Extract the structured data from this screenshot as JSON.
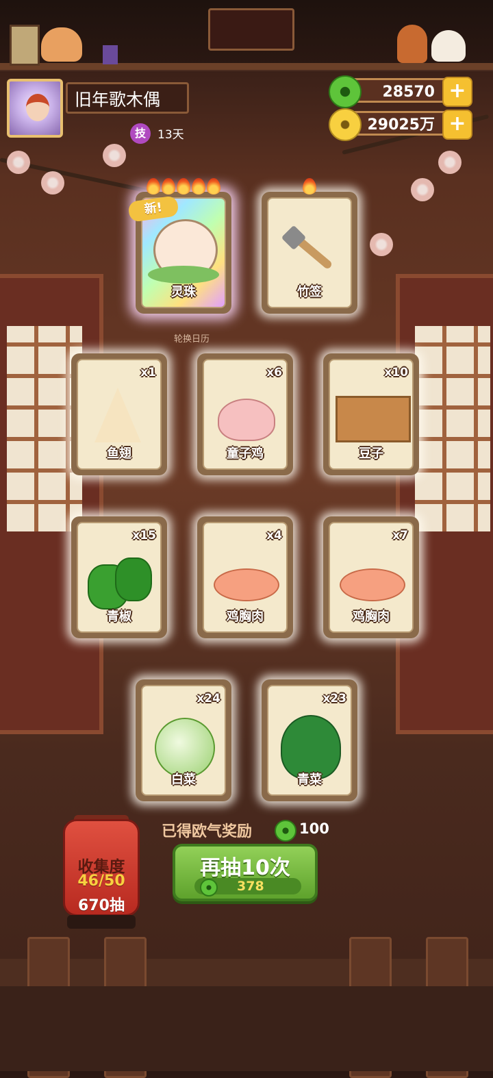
{
  "player": {
    "name": "旧年歌木偶",
    "skill_badge": "技",
    "skill_days": "13天"
  },
  "currency": [
    {
      "name": "jade",
      "value": "28570",
      "plus": "+"
    },
    {
      "name": "coins",
      "value": "29025万",
      "plus": "+"
    }
  ],
  "calendar_label": "轮换日历",
  "cards": [
    {
      "name": "灵珠",
      "count": "",
      "flames": 5,
      "new_label": "新!",
      "rare": true
    },
    {
      "name": "竹签",
      "count": "",
      "flames": 1
    },
    {
      "name": "鱼翅",
      "count": "x1"
    },
    {
      "name": "童子鸡",
      "count": "x6"
    },
    {
      "name": "豆子",
      "count": "x10"
    },
    {
      "name": "青椒",
      "count": "x15"
    },
    {
      "name": "鸡胸肉",
      "count": "x4"
    },
    {
      "name": "鸡胸肉",
      "count": "x7"
    },
    {
      "name": "白菜",
      "count": "x24"
    },
    {
      "name": "青菜",
      "count": "x23"
    }
  ],
  "reward": {
    "label": "已得欧气奖励",
    "value": "100"
  },
  "draw_button": {
    "label": "再抽10次",
    "cost": "378"
  },
  "collection": {
    "title": "收集度",
    "progress": "46/50",
    "draws": "670抽"
  },
  "colors": {
    "accent_green": "#5ea22c",
    "lantern_red": "#c8342a",
    "gold": "#f5c030"
  }
}
